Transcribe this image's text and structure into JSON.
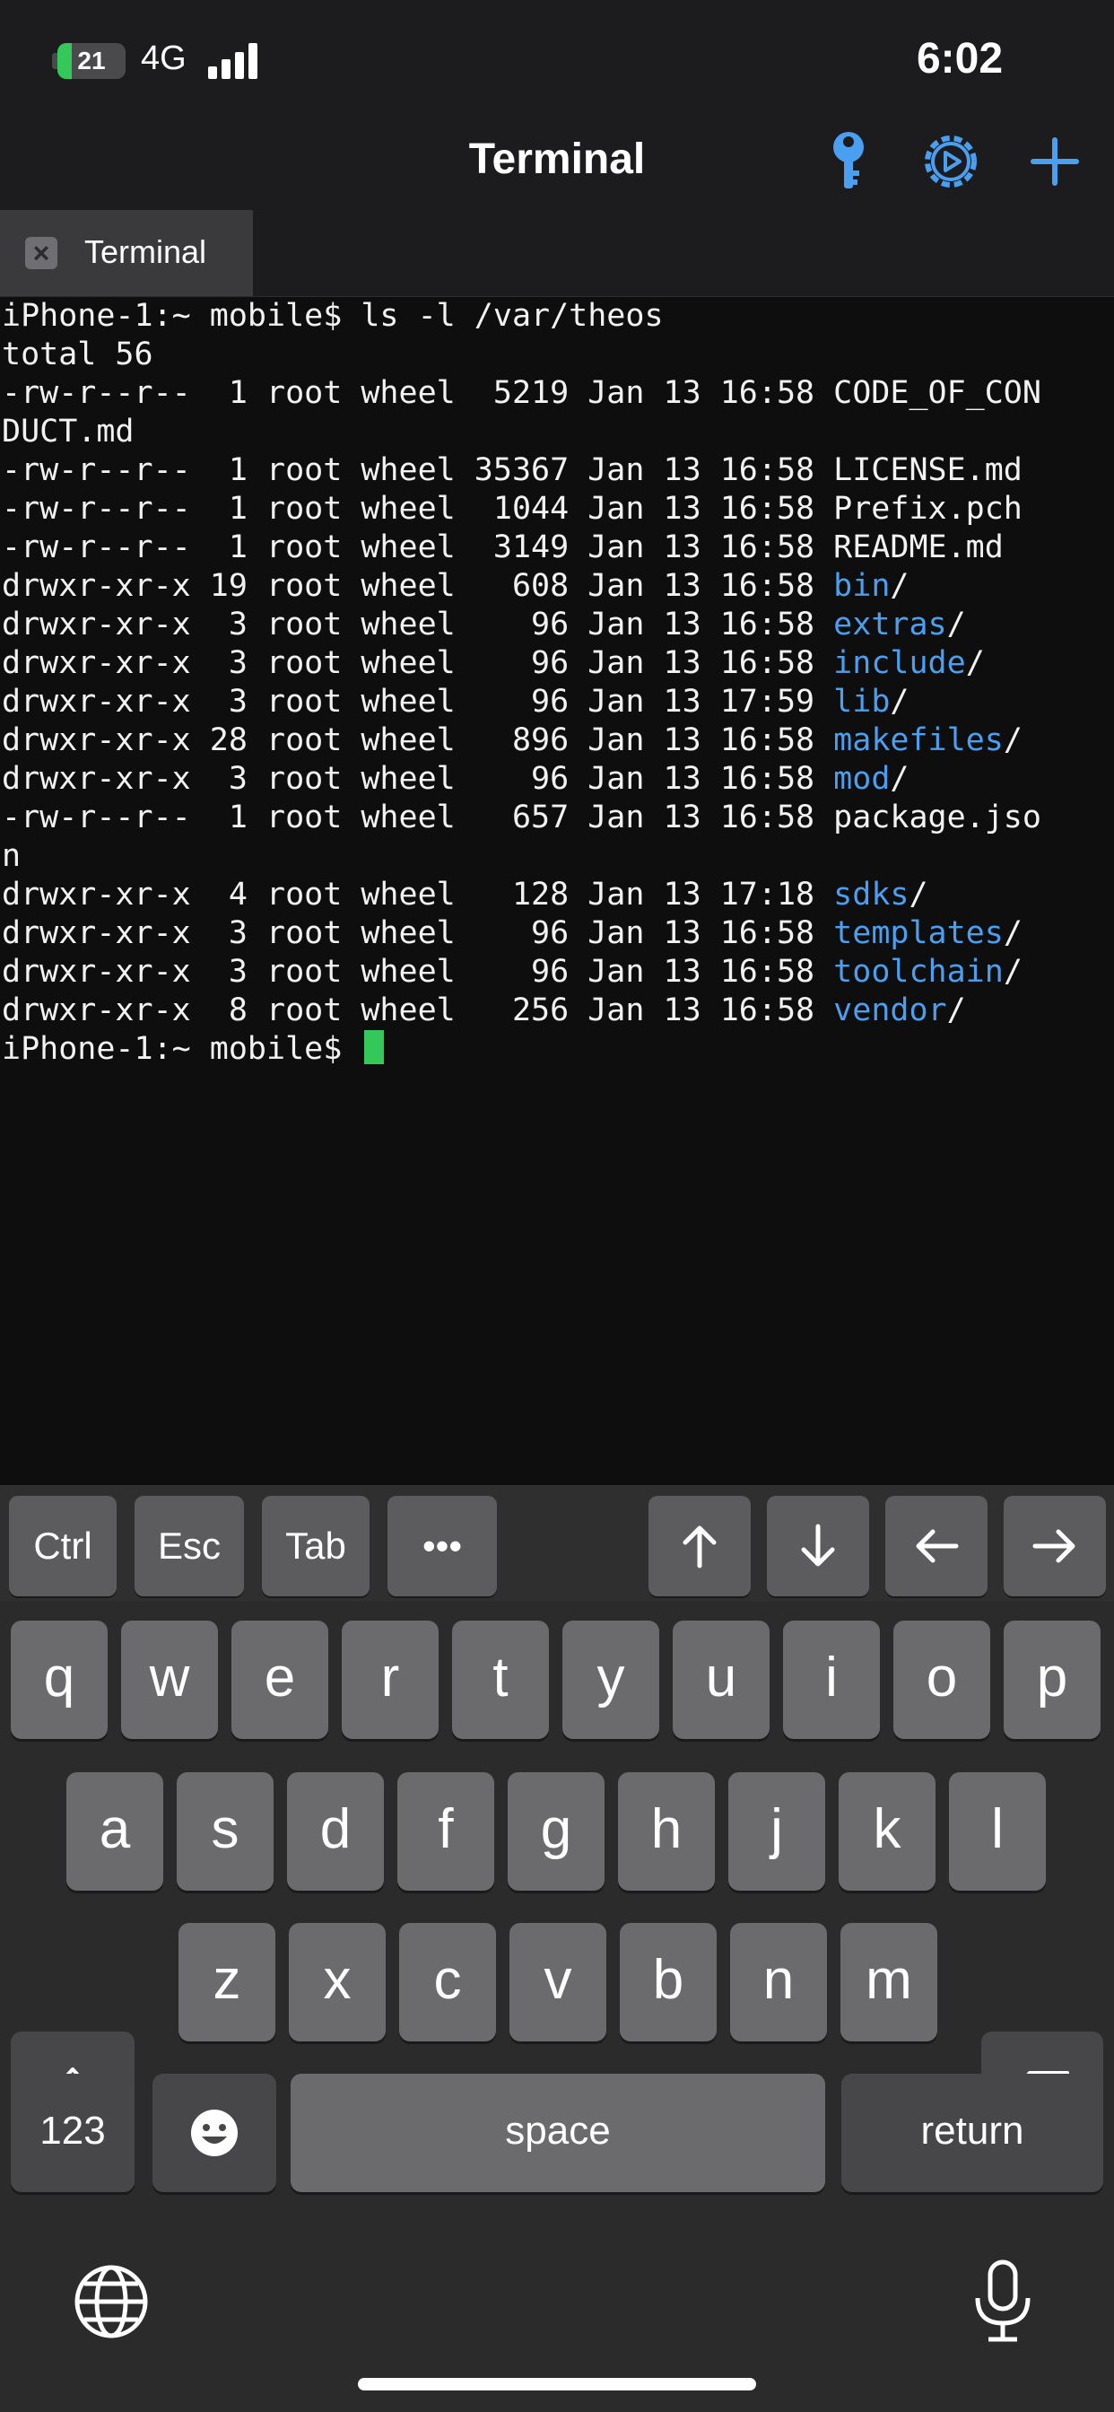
{
  "status_bar": {
    "battery_level": 21,
    "battery_text": "21",
    "network": "4G",
    "time": "6:02",
    "battery_color": "#34c759"
  },
  "nav_bar": {
    "title": "Terminal",
    "icons": [
      "key-icon",
      "gear-icon",
      "plus-icon"
    ],
    "accent_color": "#4a9ff0"
  },
  "tabs": [
    {
      "label": "Terminal",
      "close_icon": "close-icon"
    }
  ],
  "terminal": {
    "dir_color": "#4a9ff0",
    "cursor_color": "#34c759",
    "lines": [
      {
        "text": "iPhone-1:~ mobile$ ls -l /var/theos",
        "dir": "",
        "suffix": ""
      },
      {
        "text": "total 56",
        "dir": "",
        "suffix": ""
      },
      {
        "text": "-rw-r--r--  1 root wheel  5219 Jan 13 16:58 CODE_OF_CON",
        "dir": "",
        "suffix": ""
      },
      {
        "text": "DUCT.md",
        "dir": "",
        "suffix": ""
      },
      {
        "text": "-rw-r--r--  1 root wheel 35367 Jan 13 16:58 LICENSE.md",
        "dir": "",
        "suffix": ""
      },
      {
        "text": "-rw-r--r--  1 root wheel  1044 Jan 13 16:58 Prefix.pch",
        "dir": "",
        "suffix": ""
      },
      {
        "text": "-rw-r--r--  1 root wheel  3149 Jan 13 16:58 README.md",
        "dir": "",
        "suffix": ""
      },
      {
        "text": "drwxr-xr-x 19 root wheel   608 Jan 13 16:58 ",
        "dir": "bin",
        "suffix": "/"
      },
      {
        "text": "drwxr-xr-x  3 root wheel    96 Jan 13 16:58 ",
        "dir": "extras",
        "suffix": "/"
      },
      {
        "text": "drwxr-xr-x  3 root wheel    96 Jan 13 16:58 ",
        "dir": "include",
        "suffix": "/"
      },
      {
        "text": "drwxr-xr-x  3 root wheel    96 Jan 13 17:59 ",
        "dir": "lib",
        "suffix": "/"
      },
      {
        "text": "drwxr-xr-x 28 root wheel   896 Jan 13 16:58 ",
        "dir": "makefiles",
        "suffix": "/"
      },
      {
        "text": "drwxr-xr-x  3 root wheel    96 Jan 13 16:58 ",
        "dir": "mod",
        "suffix": "/"
      },
      {
        "text": "-rw-r--r--  1 root wheel   657 Jan 13 16:58 package.jso",
        "dir": "",
        "suffix": ""
      },
      {
        "text": "n",
        "dir": "",
        "suffix": ""
      },
      {
        "text": "drwxr-xr-x  4 root wheel   128 Jan 13 17:18 ",
        "dir": "sdks",
        "suffix": "/"
      },
      {
        "text": "drwxr-xr-x  3 root wheel    96 Jan 13 16:58 ",
        "dir": "templates",
        "suffix": "/"
      },
      {
        "text": "drwxr-xr-x  3 root wheel    96 Jan 13 16:58 ",
        "dir": "toolchain",
        "suffix": "/"
      },
      {
        "text": "drwxr-xr-x  8 root wheel   256 Jan 13 16:58 ",
        "dir": "vendor",
        "suffix": "/"
      }
    ],
    "prompt": "iPhone-1:~ mobile$ "
  },
  "accessory_bar": {
    "ctrl": "Ctrl",
    "esc": "Esc",
    "tab": "Tab",
    "more": "•••",
    "arrow_icons": [
      "arrow-up-icon",
      "arrow-down-icon",
      "arrow-left-icon",
      "arrow-right-icon"
    ]
  },
  "keyboard": {
    "row1": [
      "q",
      "w",
      "e",
      "r",
      "t",
      "y",
      "u",
      "i",
      "o",
      "p"
    ],
    "row2": [
      "a",
      "s",
      "d",
      "f",
      "g",
      "h",
      "j",
      "k",
      "l"
    ],
    "row3": [
      "z",
      "x",
      "c",
      "v",
      "b",
      "n",
      "m"
    ],
    "numbers_label": "123",
    "space_label": "space",
    "return_label": "return",
    "icons": [
      "shift-icon",
      "delete-icon",
      "emoji-icon",
      "globe-icon",
      "microphone-icon"
    ]
  }
}
